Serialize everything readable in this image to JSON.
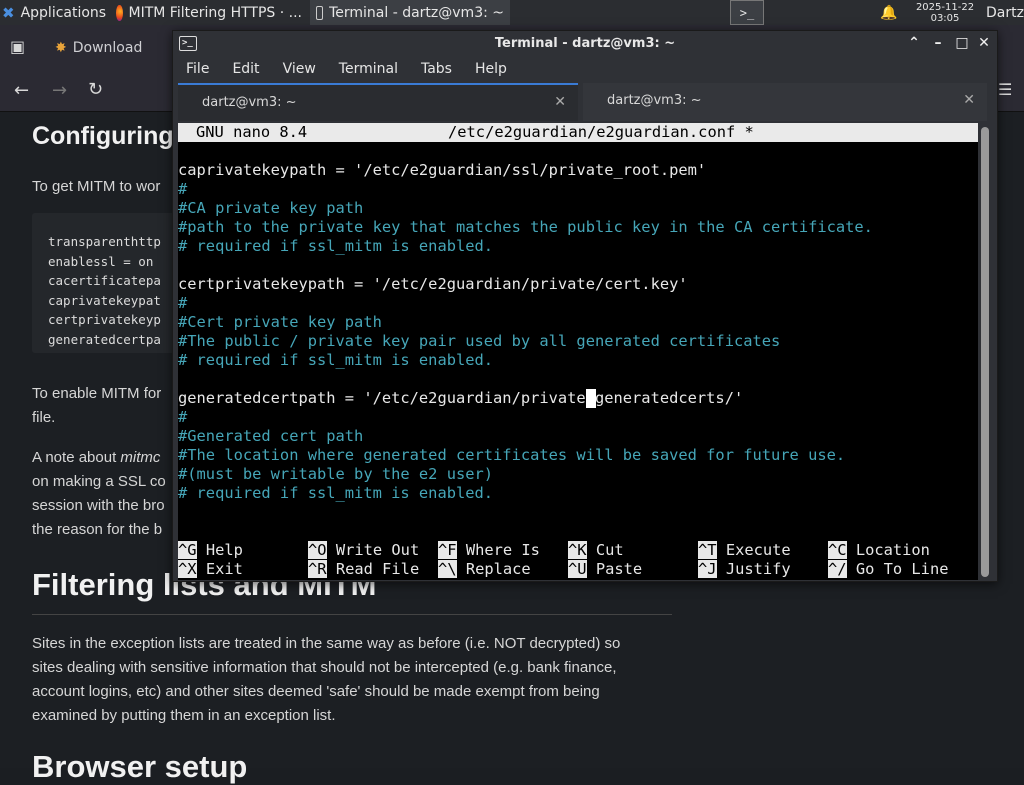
{
  "panel": {
    "apps_label": "Applications",
    "task1": "MITM Filtering HTTPS · ...",
    "task2": "Terminal - dartz@vm3: ~",
    "date": "2025-11-22",
    "time": "03:05",
    "user": "Dartz"
  },
  "browser": {
    "bookmark": "Download",
    "h_config": "Configuring",
    "p_getmitm": "To get MITM to wor",
    "code": [
      "transparenthttp",
      "enablessl = on",
      "cacertificatepa",
      "caprivatekeypat",
      "certprivatekeyp",
      "generatedcertpa"
    ],
    "p_enable_1": "To enable MITM for",
    "p_enable_2": "file.",
    "p_note_1a": "A note about ",
    "p_note_1b": "mitmc",
    "p_note_2": "on making a SSL co",
    "p_note_3": "session with the bro",
    "p_note_4": "the reason for the b",
    "h_filtering": "Filtering lists and MITM",
    "p_sites": [
      "Sites in the exception lists are treated in the same way as before (i.e. NOT decrypted) so",
      "sites dealing with sensitive information that should not be intercepted (e.g. bank finance,",
      "account logins, etc) and other sites deemed 'safe' should be made exempt from being",
      "examined by putting them in an exception list."
    ],
    "h_browser": "Browser setup"
  },
  "terminal": {
    "title": "Terminal - dartz@vm3: ~",
    "menu": [
      "File",
      "Edit",
      "View",
      "Terminal",
      "Tabs",
      "Help"
    ],
    "tabs": [
      "dartz@vm3: ~",
      "dartz@vm3: ~"
    ],
    "nano_version": "GNU nano 8.4",
    "nano_file": "/etc/e2guardian/e2guardian.conf *",
    "lines": [
      {
        "t": "caprivatekeypath = '/etc/e2guardian/ssl/private_root.pem'",
        "c": false
      },
      {
        "t": "#",
        "c": true
      },
      {
        "t": "#CA private key path",
        "c": true
      },
      {
        "t": "#path to the private key that matches the public key in the CA certificate.",
        "c": true
      },
      {
        "t": "# required if ssl_mitm is enabled.",
        "c": true
      },
      {
        "t": "",
        "c": false
      },
      {
        "t": "certprivatekeypath = '/etc/e2guardian/private/cert.key'",
        "c": false
      },
      {
        "t": "#",
        "c": true
      },
      {
        "t": "#Cert private key path",
        "c": true
      },
      {
        "t": "#The public / private key pair used by all generated certificates",
        "c": true
      },
      {
        "t": "# required if ssl_mitm is enabled.",
        "c": true
      },
      {
        "t": "",
        "c": false
      },
      {
        "t": "generatedcertpath = '/etc/e2guardian/private/generatedcerts/'",
        "c": false
      },
      {
        "t": "#",
        "c": true
      },
      {
        "t": "#Generated cert path",
        "c": true
      },
      {
        "t": "#The location where generated certificates will be saved for future use.",
        "c": true
      },
      {
        "t": "#(must be writable by the e2 user)",
        "c": true
      },
      {
        "t": "# required if ssl_mitm is enabled.",
        "c": true
      }
    ],
    "shortcuts_row1": [
      {
        "k": "^G",
        "d": "Help"
      },
      {
        "k": "^O",
        "d": "Write Out"
      },
      {
        "k": "^F",
        "d": "Where Is"
      },
      {
        "k": "^K",
        "d": "Cut"
      },
      {
        "k": "^T",
        "d": "Execute"
      },
      {
        "k": "^C",
        "d": "Location"
      }
    ],
    "shortcuts_row2": [
      {
        "k": "^X",
        "d": "Exit"
      },
      {
        "k": "^R",
        "d": "Read File"
      },
      {
        "k": "^\\",
        "d": "Replace"
      },
      {
        "k": "^U",
        "d": "Paste"
      },
      {
        "k": "^J",
        "d": "Justify"
      },
      {
        "k": "^/",
        "d": "Go To Line"
      }
    ]
  },
  "colors": {
    "comment": "#46a6b8",
    "accent": "#3a7bd5"
  }
}
